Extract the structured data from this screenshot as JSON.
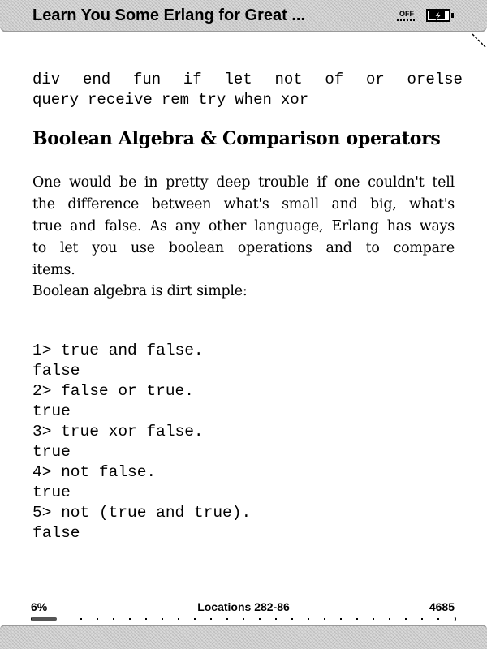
{
  "header": {
    "book_title": "Learn You Some Erlang for Great ...",
    "wireless_status": "OFF",
    "battery_icon": "battery-charging-icon"
  },
  "content": {
    "keywords": {
      "line1": [
        "div",
        "end",
        "fun",
        "if",
        "let",
        "not",
        "of",
        "or",
        "orelse"
      ],
      "line2": [
        "query",
        "receive",
        "rem",
        "try",
        "when",
        "xor"
      ]
    },
    "heading": "Boolean Algebra & Comparison operators",
    "paragraph_lines": [
      "One would be in pretty deep trouble if one couldn't tell",
      "the difference between what's small and big, what's",
      "true and false. As any other language, Erlang has ways",
      "to let you use boolean operations and to compare",
      "items."
    ],
    "intro": "Boolean algebra is dirt simple:",
    "code_lines": [
      "1> true and false.",
      "false",
      "2> false or true.",
      "true",
      "3> true xor false.",
      "true",
      "4> not false.",
      "true",
      "5> not (true and true).",
      "false"
    ]
  },
  "footer": {
    "percent_read": "6%",
    "locations": "Locations 282-86",
    "total": "4685",
    "progress_fraction": 0.06
  }
}
